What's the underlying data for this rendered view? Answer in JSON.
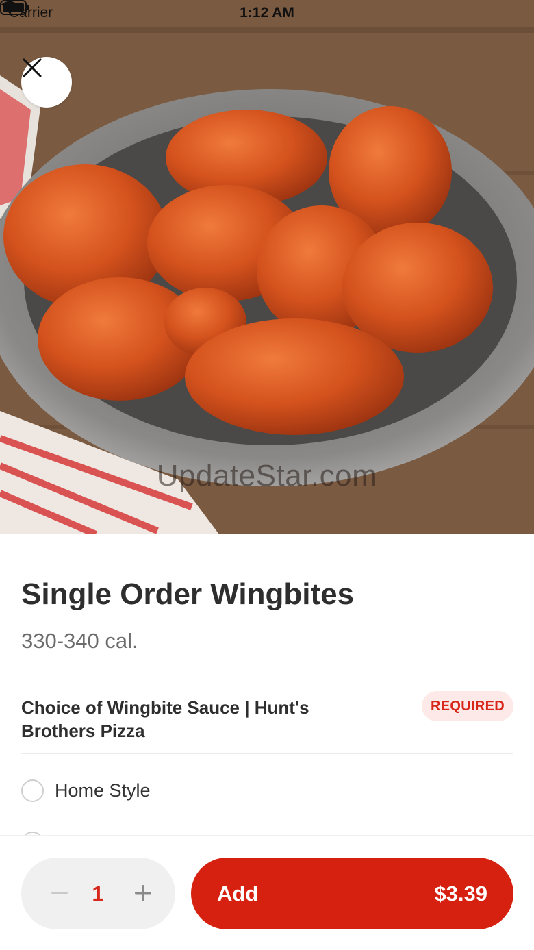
{
  "status_bar": {
    "carrier": "Carrier",
    "time": "1:12 AM"
  },
  "hero": {
    "image_subject": "plate of saucy boneless wing bites on wooden table",
    "watermark": "UpdateStar.com"
  },
  "item": {
    "title": "Single Order Wingbites",
    "calories": "330-340 cal."
  },
  "section": {
    "title": "Choice of Wingbite Sauce | Hunt's Brothers Pizza",
    "badge": "REQUIRED"
  },
  "options": [
    {
      "label": "Home Style",
      "selected": false
    }
  ],
  "cart": {
    "quantity": "1",
    "add_label": "Add",
    "price": "$3.39"
  },
  "colors": {
    "accent": "#d72110",
    "badge_bg": "#fde9e7",
    "badge_text": "#d7261a",
    "stepper_bg": "#f0f0f0"
  },
  "icons": {
    "close": "close-icon",
    "minus": "minus-icon",
    "plus": "plus-icon",
    "wifi": "wifi-icon",
    "battery": "battery-icon"
  }
}
